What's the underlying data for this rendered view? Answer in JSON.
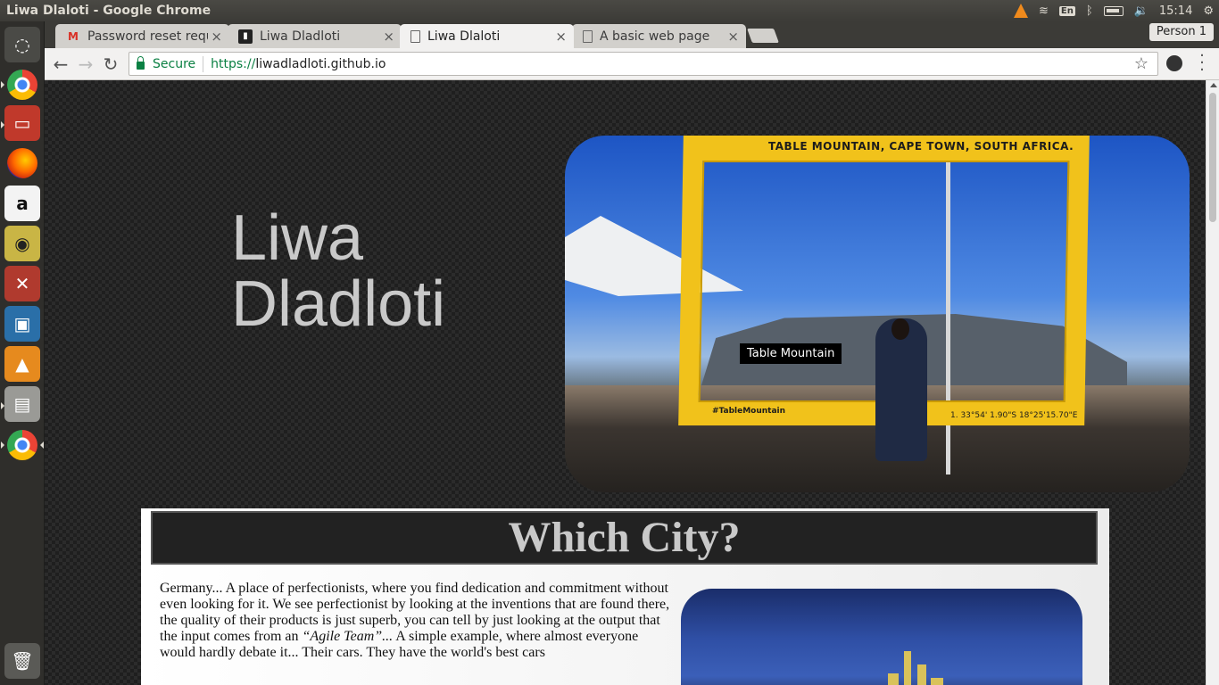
{
  "system": {
    "window_title": "Liwa Dlaloti - Google Chrome",
    "clock": "15:14",
    "keyboard_layout": "En"
  },
  "browser": {
    "tabs": [
      {
        "label": "Password reset reque",
        "icon": "gmail-icon",
        "active": false
      },
      {
        "label": "Liwa Dladloti",
        "icon": "github-icon",
        "active": false
      },
      {
        "label": "Liwa Dlaloti",
        "icon": "document-icon",
        "active": true
      },
      {
        "label": "A basic web page",
        "icon": "document-icon",
        "active": false
      }
    ],
    "tab_close_glyph": "×",
    "profile_label": "Person 1",
    "secure_label": "Secure",
    "url_scheme": "https://",
    "url_host": "liwadladloti.github.io"
  },
  "page": {
    "hero_name_line1": "Liwa",
    "hero_name_line2": "Dladloti",
    "photo_tooltip": "Table Mountain",
    "photo_frame_caption": "TABLE MOUNTAIN, CAPE TOWN, SOUTH AFRICA.",
    "photo_frame_tag": "#TableMountain",
    "photo_frame_coords": "1. 33°54'  1.90\"S  18°25'15.70\"E",
    "city_heading": "Which City?",
    "city_paragraph_part1": "Germany... A place of perfectionists, where you find dedication and commitment without even looking for it. We see perfectionist by looking at the inventions that are found there, the quality of their products is just superb, you can tell by just looking at the output that the input comes from an ",
    "city_paragraph_emphasis": "“Agile Team”...",
    "city_paragraph_part2": " A simple example, where almost everyone would hardly debate it... Their cars. They have the world's best cars"
  },
  "colors": {
    "accent_secure": "#0b8043",
    "frame_yellow": "#f1c21b",
    "page_background": "#2b2b2b"
  }
}
